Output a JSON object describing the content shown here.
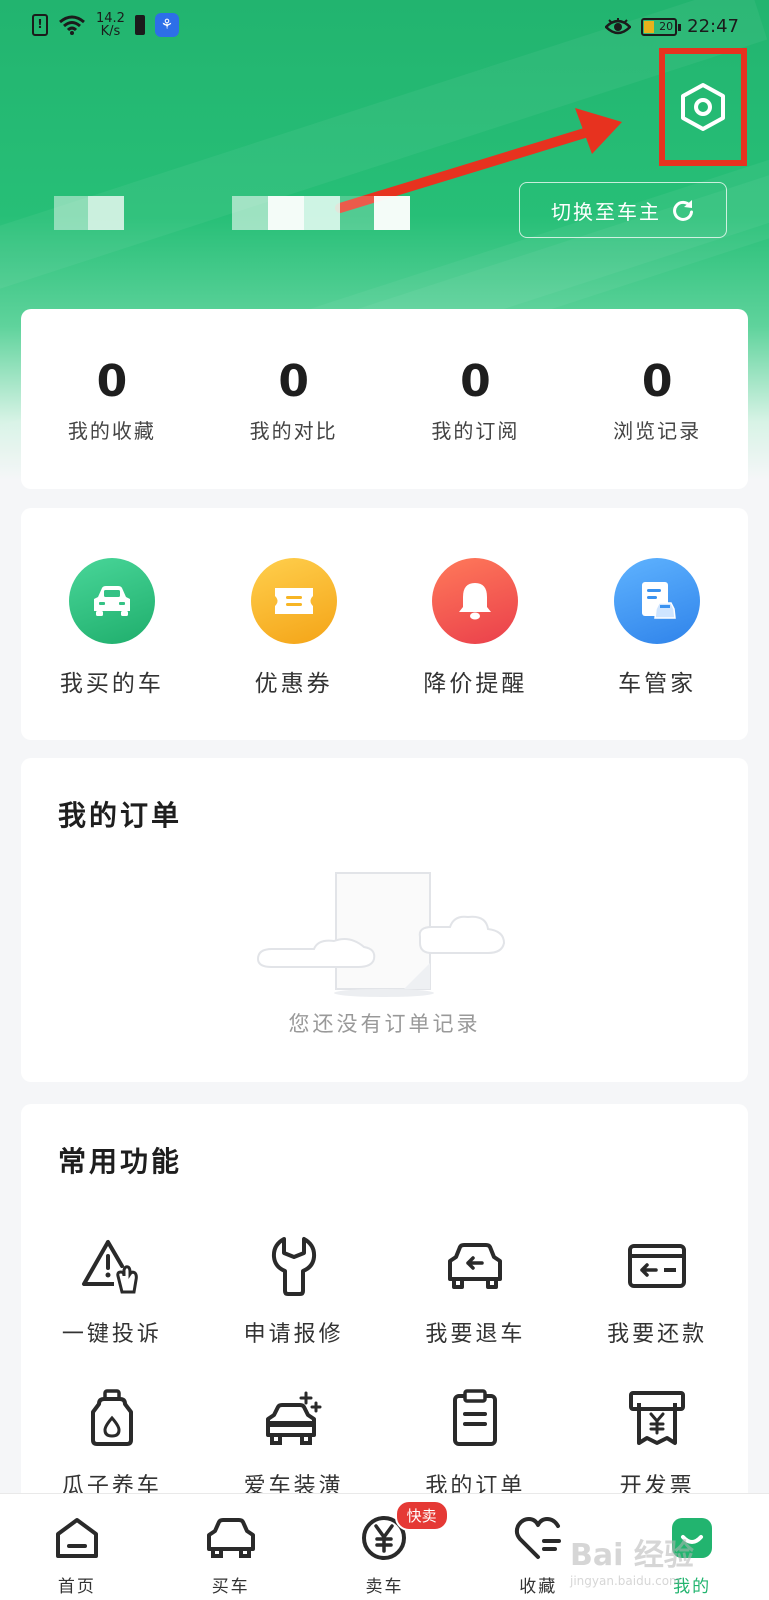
{
  "status_bar": {
    "sim_label": "!",
    "net_speed_value": "14.2",
    "net_speed_unit": "K/s",
    "battery_level": "20",
    "time": "22:47"
  },
  "header": {
    "switch_label": "切换至车主"
  },
  "stats": [
    {
      "value": "0",
      "label": "我的收藏"
    },
    {
      "value": "0",
      "label": "我的对比"
    },
    {
      "value": "0",
      "label": "我的订阅"
    },
    {
      "value": "0",
      "label": "浏览记录"
    }
  ],
  "quick_actions": [
    {
      "label": "我买的车",
      "icon": "car-icon",
      "color": "#2ec27e"
    },
    {
      "label": "优惠券",
      "icon": "coupon-icon",
      "color": "#f7b524"
    },
    {
      "label": "降价提醒",
      "icon": "bell-icon",
      "color": "#f04b4b"
    },
    {
      "label": "车管家",
      "icon": "car-document-icon",
      "color": "#3a92f0"
    }
  ],
  "orders": {
    "title": "我的订单",
    "empty_text": "您还没有订单记录"
  },
  "features": {
    "title": "常用功能",
    "items": [
      {
        "label": "一键投诉",
        "icon": "warning-hand-icon"
      },
      {
        "label": "申请报修",
        "icon": "wrench-icon"
      },
      {
        "label": "我要退车",
        "icon": "car-return-icon"
      },
      {
        "label": "我要还款",
        "icon": "card-return-icon"
      },
      {
        "label": "瓜子养车",
        "icon": "oil-bottle-icon"
      },
      {
        "label": "爱车装潢",
        "icon": "car-sparkle-icon"
      },
      {
        "label": "我的订单",
        "icon": "clipboard-icon"
      },
      {
        "label": "开发票",
        "icon": "invoice-icon"
      }
    ]
  },
  "tabbar": {
    "items": [
      {
        "label": "首页",
        "icon": "home-icon"
      },
      {
        "label": "买车",
        "icon": "car-outline-icon"
      },
      {
        "label": "卖车",
        "icon": "yen-circle-icon",
        "badge": "快卖"
      },
      {
        "label": "收藏",
        "icon": "heart-icon"
      },
      {
        "label": "我的",
        "icon": "profile-icon",
        "active": true
      }
    ]
  },
  "watermark": {
    "brand": "Bai 经验",
    "url": "jingyan.baidu.com"
  },
  "colors": {
    "brand_green": "#22b46f",
    "highlight_red": "#e7321f",
    "badge_red": "#e53935"
  }
}
